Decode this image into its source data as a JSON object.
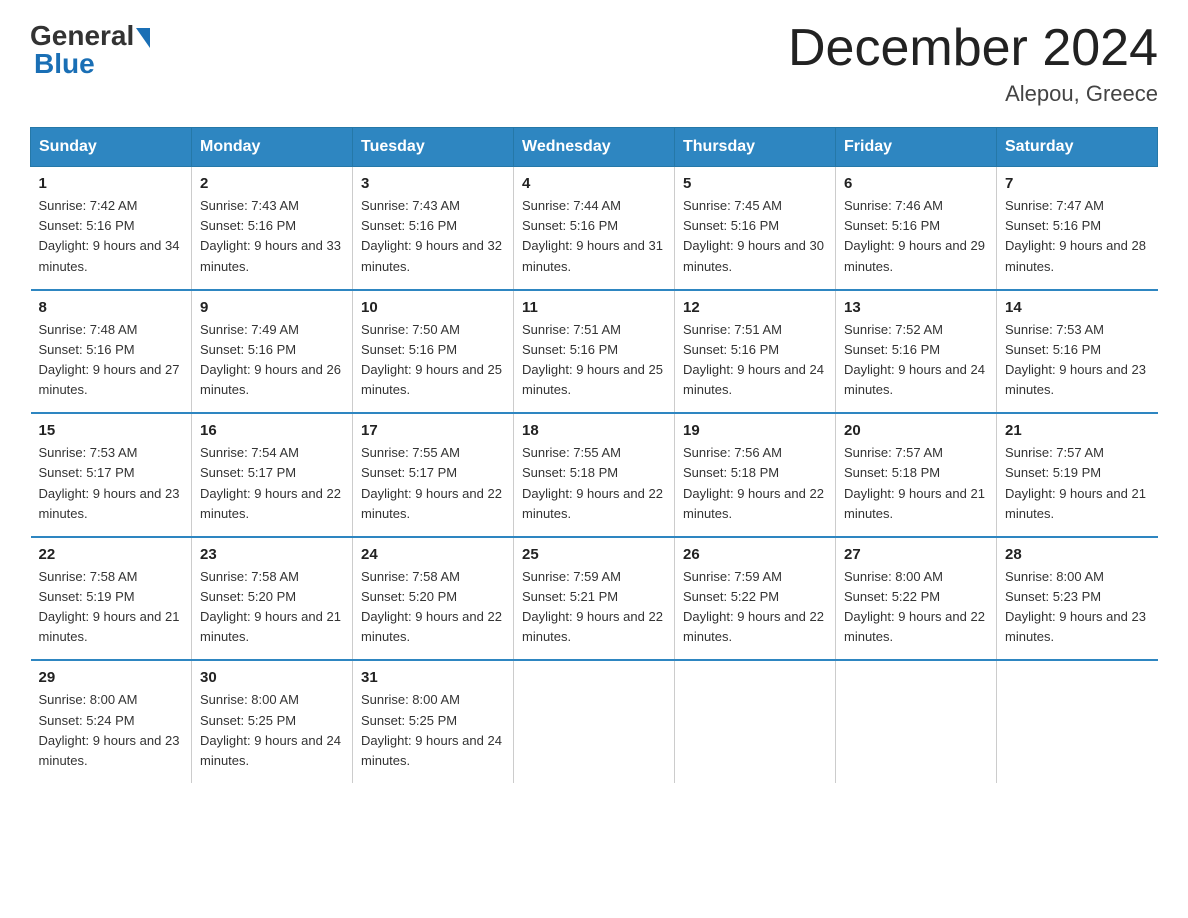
{
  "logo": {
    "general": "General",
    "blue": "Blue"
  },
  "title": "December 2024",
  "location": "Alepou, Greece",
  "days_of_week": [
    "Sunday",
    "Monday",
    "Tuesday",
    "Wednesday",
    "Thursday",
    "Friday",
    "Saturday"
  ],
  "weeks": [
    [
      {
        "day": "1",
        "sunrise": "7:42 AM",
        "sunset": "5:16 PM",
        "daylight": "9 hours and 34 minutes."
      },
      {
        "day": "2",
        "sunrise": "7:43 AM",
        "sunset": "5:16 PM",
        "daylight": "9 hours and 33 minutes."
      },
      {
        "day": "3",
        "sunrise": "7:43 AM",
        "sunset": "5:16 PM",
        "daylight": "9 hours and 32 minutes."
      },
      {
        "day": "4",
        "sunrise": "7:44 AM",
        "sunset": "5:16 PM",
        "daylight": "9 hours and 31 minutes."
      },
      {
        "day": "5",
        "sunrise": "7:45 AM",
        "sunset": "5:16 PM",
        "daylight": "9 hours and 30 minutes."
      },
      {
        "day": "6",
        "sunrise": "7:46 AM",
        "sunset": "5:16 PM",
        "daylight": "9 hours and 29 minutes."
      },
      {
        "day": "7",
        "sunrise": "7:47 AM",
        "sunset": "5:16 PM",
        "daylight": "9 hours and 28 minutes."
      }
    ],
    [
      {
        "day": "8",
        "sunrise": "7:48 AM",
        "sunset": "5:16 PM",
        "daylight": "9 hours and 27 minutes."
      },
      {
        "day": "9",
        "sunrise": "7:49 AM",
        "sunset": "5:16 PM",
        "daylight": "9 hours and 26 minutes."
      },
      {
        "day": "10",
        "sunrise": "7:50 AM",
        "sunset": "5:16 PM",
        "daylight": "9 hours and 25 minutes."
      },
      {
        "day": "11",
        "sunrise": "7:51 AM",
        "sunset": "5:16 PM",
        "daylight": "9 hours and 25 minutes."
      },
      {
        "day": "12",
        "sunrise": "7:51 AM",
        "sunset": "5:16 PM",
        "daylight": "9 hours and 24 minutes."
      },
      {
        "day": "13",
        "sunrise": "7:52 AM",
        "sunset": "5:16 PM",
        "daylight": "9 hours and 24 minutes."
      },
      {
        "day": "14",
        "sunrise": "7:53 AM",
        "sunset": "5:16 PM",
        "daylight": "9 hours and 23 minutes."
      }
    ],
    [
      {
        "day": "15",
        "sunrise": "7:53 AM",
        "sunset": "5:17 PM",
        "daylight": "9 hours and 23 minutes."
      },
      {
        "day": "16",
        "sunrise": "7:54 AM",
        "sunset": "5:17 PM",
        "daylight": "9 hours and 22 minutes."
      },
      {
        "day": "17",
        "sunrise": "7:55 AM",
        "sunset": "5:17 PM",
        "daylight": "9 hours and 22 minutes."
      },
      {
        "day": "18",
        "sunrise": "7:55 AM",
        "sunset": "5:18 PM",
        "daylight": "9 hours and 22 minutes."
      },
      {
        "day": "19",
        "sunrise": "7:56 AM",
        "sunset": "5:18 PM",
        "daylight": "9 hours and 22 minutes."
      },
      {
        "day": "20",
        "sunrise": "7:57 AM",
        "sunset": "5:18 PM",
        "daylight": "9 hours and 21 minutes."
      },
      {
        "day": "21",
        "sunrise": "7:57 AM",
        "sunset": "5:19 PM",
        "daylight": "9 hours and 21 minutes."
      }
    ],
    [
      {
        "day": "22",
        "sunrise": "7:58 AM",
        "sunset": "5:19 PM",
        "daylight": "9 hours and 21 minutes."
      },
      {
        "day": "23",
        "sunrise": "7:58 AM",
        "sunset": "5:20 PM",
        "daylight": "9 hours and 21 minutes."
      },
      {
        "day": "24",
        "sunrise": "7:58 AM",
        "sunset": "5:20 PM",
        "daylight": "9 hours and 22 minutes."
      },
      {
        "day": "25",
        "sunrise": "7:59 AM",
        "sunset": "5:21 PM",
        "daylight": "9 hours and 22 minutes."
      },
      {
        "day": "26",
        "sunrise": "7:59 AM",
        "sunset": "5:22 PM",
        "daylight": "9 hours and 22 minutes."
      },
      {
        "day": "27",
        "sunrise": "8:00 AM",
        "sunset": "5:22 PM",
        "daylight": "9 hours and 22 minutes."
      },
      {
        "day": "28",
        "sunrise": "8:00 AM",
        "sunset": "5:23 PM",
        "daylight": "9 hours and 23 minutes."
      }
    ],
    [
      {
        "day": "29",
        "sunrise": "8:00 AM",
        "sunset": "5:24 PM",
        "daylight": "9 hours and 23 minutes."
      },
      {
        "day": "30",
        "sunrise": "8:00 AM",
        "sunset": "5:25 PM",
        "daylight": "9 hours and 24 minutes."
      },
      {
        "day": "31",
        "sunrise": "8:00 AM",
        "sunset": "5:25 PM",
        "daylight": "9 hours and 24 minutes."
      },
      {
        "day": "",
        "sunrise": "",
        "sunset": "",
        "daylight": ""
      },
      {
        "day": "",
        "sunrise": "",
        "sunset": "",
        "daylight": ""
      },
      {
        "day": "",
        "sunrise": "",
        "sunset": "",
        "daylight": ""
      },
      {
        "day": "",
        "sunrise": "",
        "sunset": "",
        "daylight": ""
      }
    ]
  ]
}
